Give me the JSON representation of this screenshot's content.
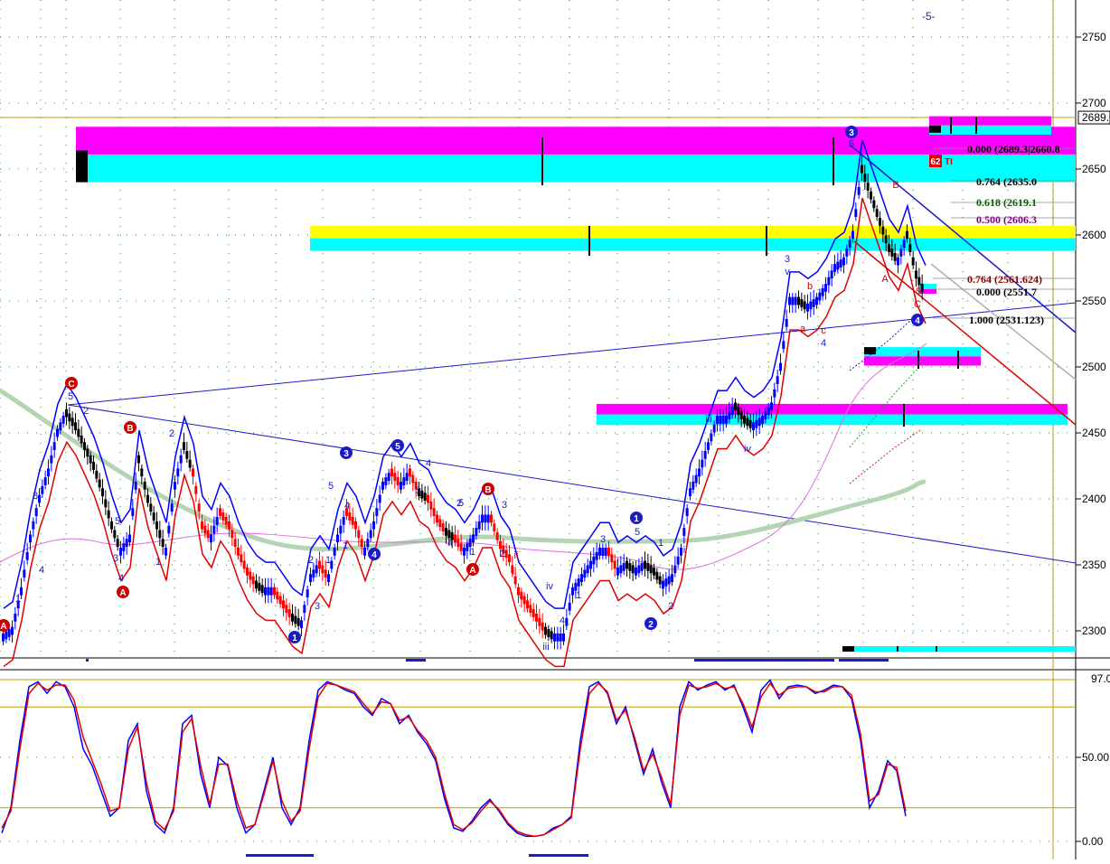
{
  "top_label": "-5-",
  "price_axis": {
    "ticks": [
      2750,
      2700,
      2650,
      2600,
      2550,
      2500,
      2450,
      2400,
      2350,
      2300
    ],
    "tick_labels": [
      "2750",
      "2700",
      "2650",
      "2600",
      "2550",
      "2500",
      "2450",
      "2400",
      "2350",
      "2300"
    ],
    "current_price_label": "2689.",
    "ylim": [
      2285,
      2775
    ]
  },
  "osc_axis": {
    "ticks": [
      50,
      0
    ],
    "tick_labels": [
      "50.00",
      "0.00"
    ],
    "top_readout": "97.0",
    "ylim": [
      -5,
      100
    ],
    "guides": [
      80,
      20
    ]
  },
  "fib_levels": [
    {
      "text": "0.000 (2689.3|2660.8",
      "color": "#000000"
    },
    {
      "text": "0.764 (2635.0",
      "color": "#000000"
    },
    {
      "text": "0.618 (2619.1",
      "color": "#006400"
    },
    {
      "text": "0.500 (2606.3",
      "color": "#800080"
    },
    {
      "text": "0.764 (2561.624)",
      "color": "#8b0000"
    },
    {
      "text": "0.000 (2551.7",
      "color": "#000000"
    },
    {
      "text": "1.000 (2531.123)",
      "color": "#000000"
    }
  ],
  "badge_text": "62",
  "badge_suffix": "TI",
  "wave_labels": {
    "circled": [
      {
        "t": "C",
        "color": "#cc0000"
      },
      {
        "t": "B",
        "color": "#cc0000"
      },
      {
        "t": "A",
        "color": "#cc0000"
      },
      {
        "t": "3",
        "color": "#1a1acc"
      },
      {
        "t": "5",
        "color": "#1a1acc"
      },
      {
        "t": "4",
        "color": "#1a1acc"
      },
      {
        "t": "B",
        "color": "#cc0000"
      },
      {
        "t": "A",
        "color": "#cc0000"
      },
      {
        "t": "1",
        "color": "#1a1acc"
      },
      {
        "t": "2",
        "color": "#1a1acc"
      },
      {
        "t": "3",
        "color": "#1a1acc"
      },
      {
        "t": "4",
        "color": "#1a1acc"
      },
      {
        "t": "1",
        "color": "#1a1acc"
      },
      {
        "t": "A",
        "color": "#cc0000"
      }
    ],
    "plain": [
      {
        "t": "5",
        "color": "#1a1acc"
      },
      {
        "t": "2",
        "color": "#1a1acc"
      },
      {
        "t": "3",
        "color": "#1a1acc"
      },
      {
        "t": "4",
        "color": "#1a1acc"
      },
      {
        "t": "1",
        "color": "#1a1acc"
      },
      {
        "t": "3",
        "color": "#1a1acc"
      },
      {
        "t": "4",
        "color": "#1a1acc"
      },
      {
        "t": "5",
        "color": "#1a1acc"
      },
      {
        "t": "1",
        "color": "#1a1acc"
      },
      {
        "t": "2",
        "color": "#1a1acc"
      },
      {
        "t": "3",
        "color": "#1a1acc"
      },
      {
        "t": "5",
        "color": "#1a1acc"
      },
      {
        "t": "4",
        "color": "#1a1acc"
      },
      {
        "t": "1",
        "color": "#1a1acc"
      },
      {
        "t": "2",
        "color": "#1a1acc"
      },
      {
        "t": "3",
        "color": "#1a1acc"
      },
      {
        "t": "4",
        "color": "#1a1acc"
      },
      {
        "t": "2",
        "color": "#1a1acc"
      },
      {
        "t": "1",
        "color": "#1a1acc"
      },
      {
        "t": "2",
        "color": "#1a1acc"
      },
      {
        "t": "3",
        "color": "#1a1acc"
      },
      {
        "t": "4",
        "color": "#1a1acc"
      },
      {
        "t": "5",
        "color": "#1a1acc"
      },
      {
        "t": "i",
        "color": "#cc0000"
      },
      {
        "t": "ii",
        "color": "#cc0000"
      },
      {
        "t": "iii",
        "color": "#1a1acc"
      },
      {
        "t": "iv",
        "color": "#1a1acc"
      },
      {
        "t": "1",
        "color": "#1a1acc"
      },
      {
        "t": "4",
        "color": "#1a1acc"
      },
      {
        "t": "3",
        "color": "#1a1acc"
      },
      {
        "t": "5",
        "color": "#1a1acc"
      },
      {
        "t": "1",
        "color": "#1a1acc"
      },
      {
        "t": "2",
        "color": "#1a1acc"
      },
      {
        "t": "i",
        "color": "#1a1acc"
      },
      {
        "t": "iii",
        "color": "#1a1acc"
      },
      {
        "t": "iv",
        "color": "#1a1acc"
      },
      {
        "t": "3",
        "color": "#1a1acc"
      },
      {
        "t": "v",
        "color": "#1a1acc"
      },
      {
        "t": "a",
        "color": "#cc0000"
      },
      {
        "t": "b",
        "color": "#cc0000"
      },
      {
        "t": "c",
        "color": "#cc0000"
      },
      {
        "t": "4",
        "color": "#1a1acc"
      },
      {
        "t": "5",
        "color": "#1a1acc"
      },
      {
        "t": "A",
        "color": "#cc0000"
      },
      {
        "t": "B",
        "color": "#cc0000"
      },
      {
        "t": "C",
        "color": "#cc0000"
      },
      {
        "t": "5",
        "color": "#cc0000"
      },
      {
        "t": "1",
        "color": "#1a1acc"
      }
    ]
  },
  "colors": {
    "zone_magenta": "#ff00ff",
    "zone_cyan": "#00ffff",
    "zone_yellow": "#ffff00",
    "candle_blue": "#0000ff",
    "candle_black": "#000000",
    "candle_red": "#ff0000",
    "band_blue": "#0000ff",
    "band_red": "#e00000",
    "ma_green": "#b4d4b4",
    "ma_magenta": "#e070e0",
    "osc_k": "#0000ff",
    "osc_d": "#e00000",
    "guide_olive": "#b8a000",
    "grid_dot": "#2a8a2a"
  },
  "chart_data": [
    {
      "type": "line",
      "name": "price-panel",
      "x": [
        0,
        10,
        20,
        30,
        40,
        50,
        60,
        70,
        80,
        90,
        100,
        110,
        120,
        130,
        140,
        150,
        160,
        170,
        180,
        190,
        200,
        210,
        220,
        230,
        240,
        250,
        260,
        270,
        280,
        290,
        300,
        310,
        320,
        330,
        340,
        350,
        360,
        370,
        380,
        390,
        400,
        410,
        420,
        430,
        440,
        450,
        460,
        470,
        480,
        490,
        500,
        510,
        520,
        530,
        540,
        550,
        560,
        570,
        580,
        590,
        600,
        610,
        620,
        630,
        640,
        650,
        660,
        670,
        680,
        690,
        700,
        710,
        720,
        730,
        740,
        750,
        760,
        770,
        780,
        790,
        800,
        810,
        820,
        830,
        840,
        850,
        860,
        870,
        880,
        890,
        900,
        910,
        920,
        930,
        940,
        950,
        960,
        970,
        980,
        990,
        1000,
        1010,
        1020
      ],
      "series_close": [
        2295,
        2300,
        2330,
        2370,
        2400,
        2420,
        2450,
        2465,
        2455,
        2440,
        2425,
        2405,
        2380,
        2360,
        2370,
        2430,
        2400,
        2380,
        2360,
        2410,
        2440,
        2420,
        2380,
        2370,
        2390,
        2380,
        2360,
        2345,
        2335,
        2330,
        2330,
        2320,
        2310,
        2305,
        2340,
        2350,
        2340,
        2370,
        2390,
        2380,
        2360,
        2380,
        2410,
        2420,
        2410,
        2420,
        2405,
        2400,
        2385,
        2375,
        2370,
        2360,
        2370,
        2385,
        2385,
        2365,
        2355,
        2330,
        2320,
        2310,
        2300,
        2295,
        2295,
        2330,
        2340,
        2350,
        2360,
        2360,
        2345,
        2350,
        2345,
        2350,
        2345,
        2335,
        2340,
        2360,
        2405,
        2420,
        2440,
        2460,
        2460,
        2470,
        2460,
        2455,
        2460,
        2470,
        2500,
        2550,
        2550,
        2545,
        2550,
        2560,
        2575,
        2580,
        2600,
        2650,
        2630,
        2610,
        2590,
        2580,
        2600,
        2570,
        2555
      ],
      "zones": [
        {
          "low": 2640,
          "high": 2682,
          "color": "cyan-magenta"
        },
        {
          "low": 2588,
          "high": 2607,
          "color": "yellow-cyan"
        },
        {
          "low": 2456,
          "high": 2468,
          "color": "magenta-cyan"
        },
        {
          "low": 2501,
          "high": 2513,
          "color": "cyan-magenta"
        },
        {
          "low": 2676,
          "high": 2689,
          "color": "magenta-cyan"
        }
      ]
    },
    {
      "type": "line",
      "name": "oscillator",
      "x": [
        0,
        10,
        20,
        30,
        40,
        50,
        60,
        70,
        80,
        90,
        100,
        110,
        120,
        130,
        140,
        150,
        160,
        170,
        180,
        190,
        200,
        210,
        220,
        230,
        240,
        250,
        260,
        270,
        280,
        290,
        300,
        310,
        320,
        330,
        340,
        350,
        360,
        370,
        380,
        390,
        400,
        410,
        420,
        430,
        440,
        450,
        460,
        470,
        480,
        490,
        500,
        510,
        520,
        530,
        540,
        550,
        560,
        570,
        580,
        590,
        600,
        610,
        620,
        630,
        640,
        650,
        660,
        670,
        680,
        690,
        700,
        710,
        720,
        730,
        740,
        750,
        760,
        770,
        780,
        790,
        800,
        810,
        820,
        830,
        840,
        850,
        860,
        870,
        880,
        890,
        900,
        910,
        920,
        930,
        940,
        950,
        960,
        970,
        980,
        990,
        1000,
        1010,
        1020
      ],
      "series": [
        {
          "name": "%K",
          "values": [
            5,
            20,
            60,
            92,
            95,
            88,
            95,
            92,
            80,
            55,
            45,
            30,
            15,
            20,
            60,
            70,
            30,
            10,
            5,
            20,
            70,
            75,
            40,
            20,
            50,
            45,
            20,
            5,
            10,
            30,
            50,
            20,
            10,
            20,
            60,
            90,
            95,
            93,
            90,
            88,
            80,
            75,
            85,
            82,
            70,
            75,
            65,
            58,
            48,
            25,
            8,
            6,
            12,
            20,
            25,
            18,
            10,
            5,
            3,
            3,
            4,
            8,
            10,
            15,
            60,
            92,
            95,
            88,
            70,
            80,
            60,
            40,
            55,
            35,
            20,
            80,
            95,
            90,
            93,
            95,
            90,
            93,
            80,
            65,
            90,
            96,
            85,
            92,
            93,
            92,
            88,
            90,
            93,
            92,
            85,
            60,
            20,
            30,
            48,
            42,
            15
          ]
        },
        {
          "name": "%D",
          "values": [
            8,
            18,
            55,
            88,
            94,
            90,
            93,
            93,
            84,
            62,
            48,
            34,
            18,
            20,
            55,
            68,
            35,
            12,
            7,
            18,
            65,
            73,
            45,
            22,
            46,
            46,
            24,
            8,
            10,
            28,
            48,
            24,
            12,
            18,
            55,
            86,
            94,
            93,
            91,
            89,
            82,
            76,
            83,
            82,
            72,
            74,
            66,
            60,
            50,
            28,
            10,
            7,
            11,
            18,
            24,
            19,
            11,
            6,
            4,
            3,
            4,
            7,
            10,
            14,
            55,
            88,
            94,
            89,
            72,
            78,
            62,
            42,
            52,
            38,
            22,
            75,
            93,
            91,
            92,
            94,
            91,
            92,
            82,
            68,
            86,
            94,
            87,
            91,
            92,
            92,
            89,
            89,
            92,
            92,
            87,
            64,
            24,
            28,
            46,
            44,
            18
          ]
        }
      ]
    }
  ]
}
